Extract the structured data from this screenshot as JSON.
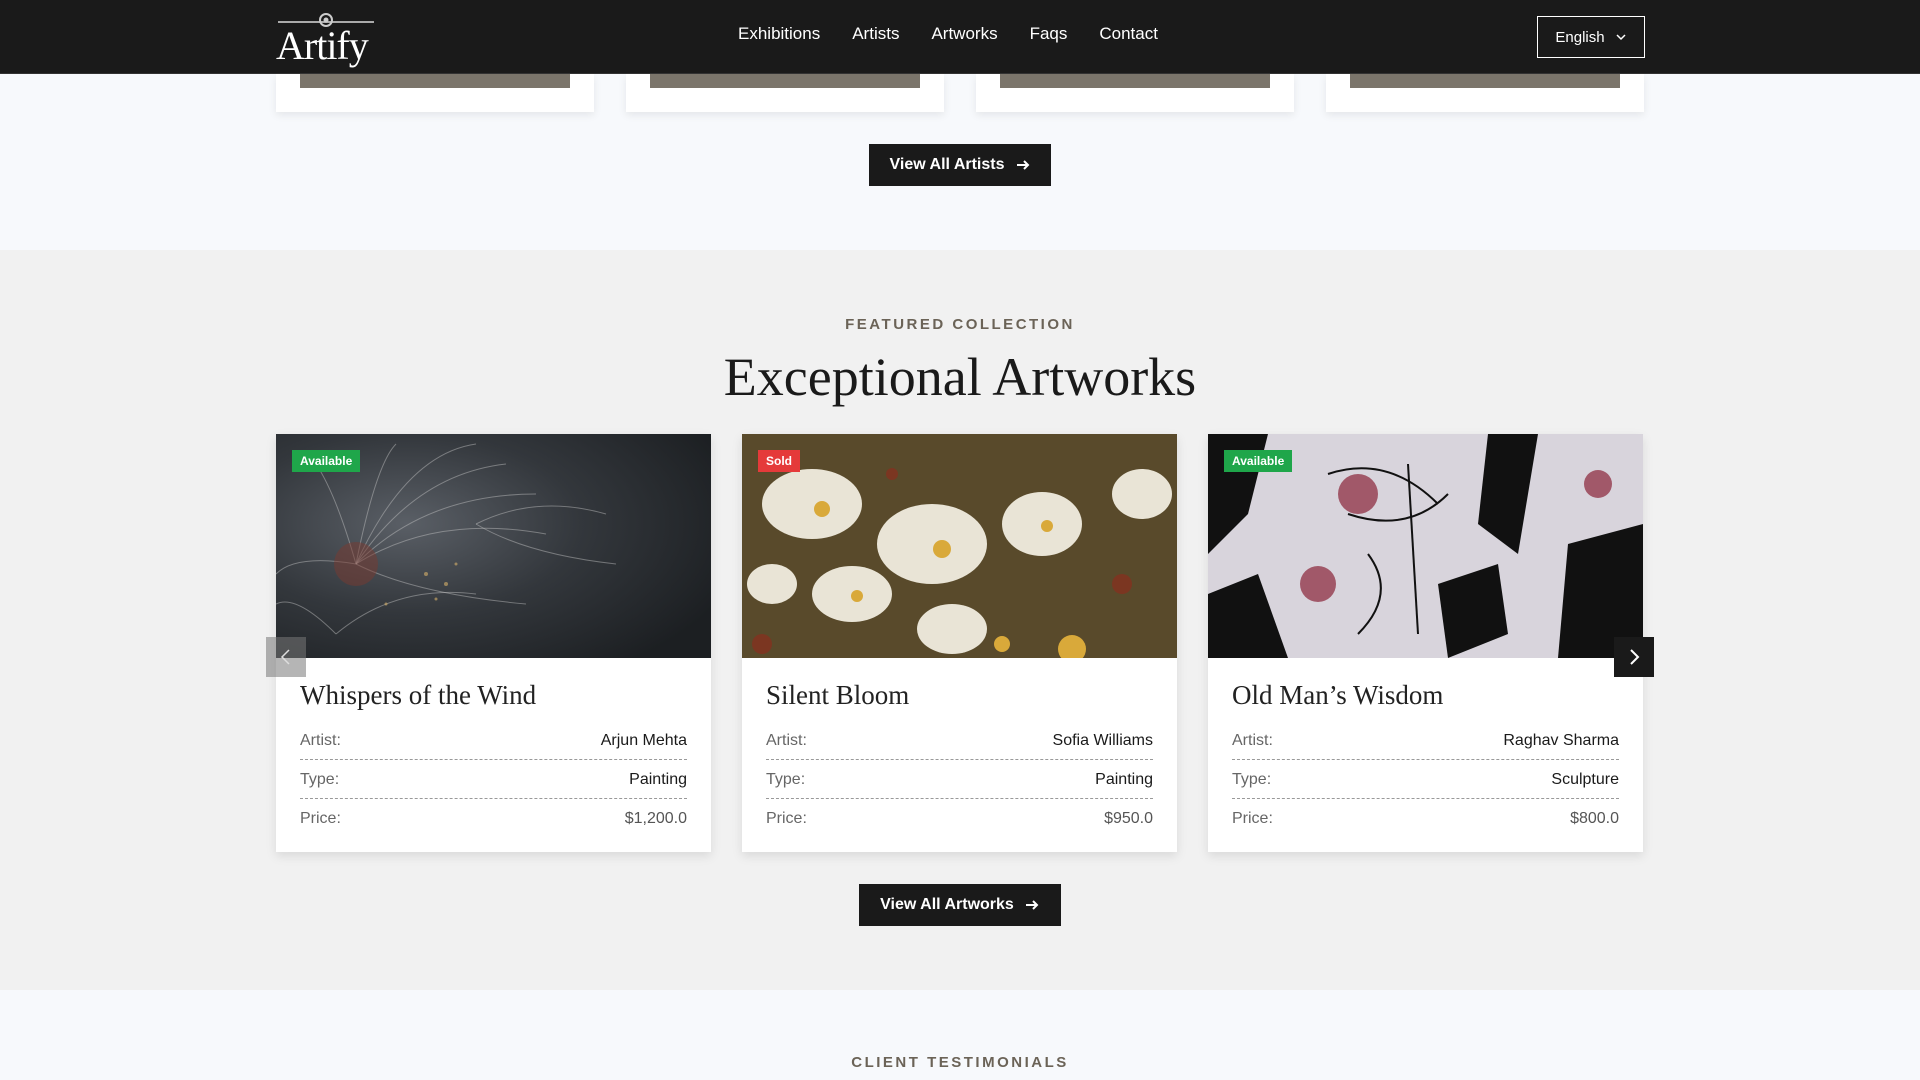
{
  "header": {
    "logo_text": "Artify",
    "nav": [
      "Exhibitions",
      "Artists",
      "Artworks",
      "Faqs",
      "Contact"
    ],
    "language": "English"
  },
  "artists": {
    "view_all_label": "View All Artists"
  },
  "featured": {
    "eyebrow": "FEATURED COLLECTION",
    "title": "Exceptional Artworks",
    "labels": {
      "artist": "Artist:",
      "type": "Type:",
      "price": "Price:"
    },
    "cards": [
      {
        "badge": "Available",
        "status": "available",
        "title": "Whispers of the Wind",
        "artist": "Arjun Mehta",
        "type": "Painting",
        "price": "$1,200.0",
        "image": "dandelion-macro-photo"
      },
      {
        "badge": "Sold",
        "status": "sold",
        "title": "Silent Bloom",
        "artist": "Sofia Williams",
        "type": "Painting",
        "price": "$950.0",
        "image": "white-flowers-oil-painting"
      },
      {
        "badge": "Available",
        "status": "available",
        "title": "Old Man’s Wisdom",
        "artist": "Raghav Sharma",
        "type": "Sculpture",
        "price": "$800.0",
        "image": "graffiti-mural"
      }
    ],
    "view_all_label": "View All Artworks"
  },
  "testimonials": {
    "eyebrow": "CLIENT TESTIMONIALS"
  },
  "colors": {
    "header_bg": "#1a1a1a",
    "accent_brown": "#7b756b",
    "available": "#1fa64a",
    "sold": "#e53a3a"
  }
}
